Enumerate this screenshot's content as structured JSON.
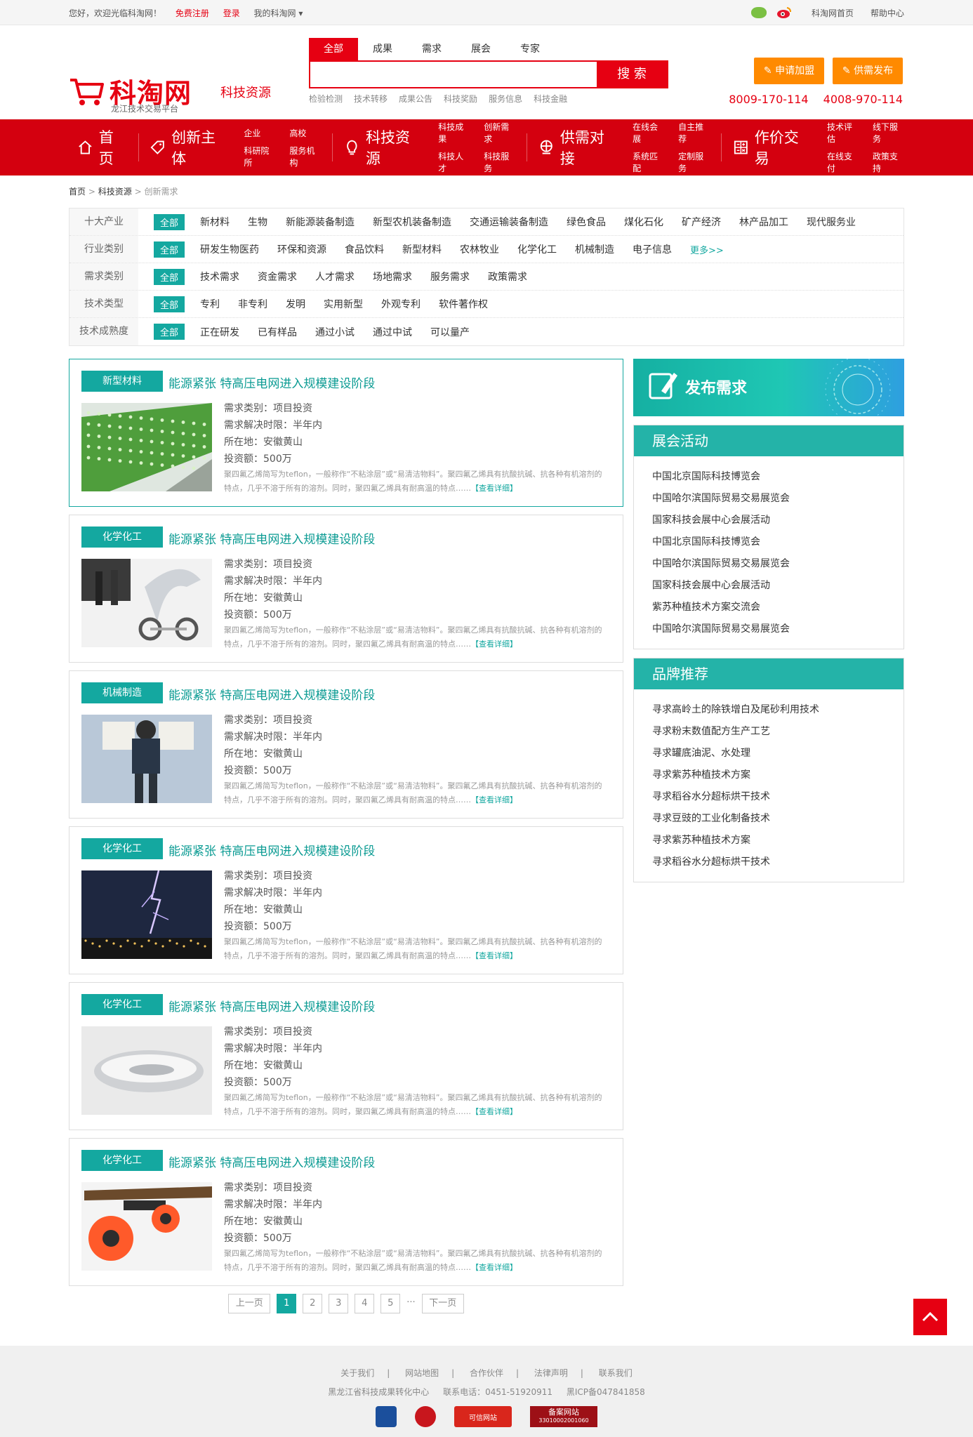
{
  "topbar": {
    "welcome": "您好，欢迎光临科淘网！",
    "register": "免费注册",
    "login": "登录",
    "my": "我的科淘网",
    "home_link": "科淘网首页",
    "help": "帮助中心"
  },
  "header": {
    "brand": "科淘网",
    "subtitle": "龙江技术交易平台",
    "section": "科技资源",
    "search_tabs": [
      "全部",
      "成果",
      "需求",
      "展会",
      "专家"
    ],
    "search_placeholder": "",
    "search_button": "搜 索",
    "hot_words": [
      "检验检测",
      "技术转移",
      "成果公告",
      "科技奖励",
      "服务信息",
      "科技金融"
    ],
    "join_button": "申请加盟",
    "publish_button": "供需发布",
    "phone1": "8009-170-114",
    "phone2": "4008-970-114"
  },
  "nav": {
    "home": "首页",
    "groups": [
      {
        "label": "创新主体",
        "subs": [
          "企业",
          "高校",
          "科研院所",
          "服务机构"
        ]
      },
      {
        "label": "科技资源",
        "subs": [
          "科技成果",
          "创新需求",
          "科技人才",
          "科技服务"
        ]
      },
      {
        "label": "供需对接",
        "subs": [
          "在线会展",
          "自主推荐",
          "系统匹配",
          "定制服务"
        ]
      },
      {
        "label": "作价交易",
        "subs": [
          "技术评估",
          "线下服务",
          "在线支付",
          "政策支持"
        ]
      }
    ]
  },
  "breadcrumb": {
    "home": "首页",
    "section": "科技资源",
    "current": "创新需求"
  },
  "filters": [
    {
      "label": "十大产业",
      "all": "全部",
      "options": [
        "新材料",
        "生物",
        "新能源装备制造",
        "新型农机装备制造",
        "交通运输装备制造",
        "绿色食品",
        "煤化石化",
        "矿产经济",
        "林产品加工",
        "现代服务业"
      ],
      "more": ""
    },
    {
      "label": "行业类别",
      "all": "全部",
      "options": [
        "研发生物医药",
        "环保和资源",
        "食品饮料",
        "新型材料",
        "农林牧业",
        "化学化工",
        "机械制造",
        "电子信息"
      ],
      "more": "更多>>"
    },
    {
      "label": "需求类别",
      "all": "全部",
      "options": [
        "技术需求",
        "资金需求",
        "人才需求",
        "场地需求",
        "服务需求",
        "政策需求"
      ],
      "more": ""
    },
    {
      "label": "技术类型",
      "all": "全部",
      "options": [
        "专利",
        "非专利",
        "发明",
        "实用新型",
        "外观专利",
        "软件著作权"
      ],
      "more": ""
    },
    {
      "label": "技术成熟度",
      "all": "全部",
      "options": [
        "正在研发",
        "已有样品",
        "通过小试",
        "通过中试",
        "可以量产"
      ],
      "more": ""
    }
  ],
  "cards": [
    {
      "tag": "新型材料",
      "title": "能源紧张 特高压电网进入规模建设阶段",
      "type": "需求类别：项目投资",
      "period": "需求解决时限：半年内",
      "location": "所在地：安徽黄山",
      "amount": "投资额：500万",
      "desc": "聚四氟乙烯简写为teflon，一般称作“不粘涂层”或“易清洁物料”。聚四氟乙烯具有抗酸抗碱、抗各种有机溶剂的特点，几乎不溶于所有的溶剂。同时，聚四氟乙烯具有耐高温的特点……",
      "more": "【查看详细】",
      "pic": "green"
    },
    {
      "tag": "化学化工",
      "title": "能源紧张 特高压电网进入规模建设阶段",
      "type": "需求类别：项目投资",
      "period": "需求解决时限：半年内",
      "location": "所在地：安徽黄山",
      "amount": "投资额：500万",
      "desc": "聚四氟乙烯简写为teflon，一般称作“不粘涂层”或“易清洁物料”。聚四氟乙烯具有抗酸抗碱、抗各种有机溶剂的特点，几乎不溶于所有的溶剂。同时，聚四氟乙烯具有耐高温的特点……",
      "more": "【查看详细】",
      "pic": "bike"
    },
    {
      "tag": "机械制造",
      "title": "能源紧张 特高压电网进入规模建设阶段",
      "type": "需求类别：项目投资",
      "period": "需求解决时限：半年内",
      "location": "所在地：安徽黄山",
      "amount": "投资额：500万",
      "desc": "聚四氟乙烯简写为teflon，一般称作“不粘涂层”或“易清洁物料”。聚四氟乙烯具有抗酸抗碱、抗各种有机溶剂的特点，几乎不溶于所有的溶剂。同时，聚四氟乙烯具有耐高温的特点……",
      "more": "【查看详细】",
      "pic": "jetpack"
    },
    {
      "tag": "化学化工",
      "title": "能源紧张 特高压电网进入规模建设阶段",
      "type": "需求类别：项目投资",
      "period": "需求解决时限：半年内",
      "location": "所在地：安徽黄山",
      "amount": "投资额：500万",
      "desc": "聚四氟乙烯简写为teflon，一般称作“不粘涂层”或“易清洁物料”。聚四氟乙烯具有抗酸抗碱、抗各种有机溶剂的特点，几乎不溶于所有的溶剂。同时，聚四氟乙烯具有耐高温的特点……",
      "more": "【查看详细】",
      "pic": "lightning"
    },
    {
      "tag": "化学化工",
      "title": "能源紧张 特高压电网进入规模建设阶段",
      "type": "需求类别：项目投资",
      "period": "需求解决时限：半年内",
      "location": "所在地：安徽黄山",
      "amount": "投资额：500万",
      "desc": "聚四氟乙烯简写为teflon，一般称作“不粘涂层”或“易清洁物料”。聚四氟乙烯具有抗酸抗碱、抗各种有机溶剂的特点，几乎不溶于所有的溶剂。同时，聚四氟乙烯具有耐高温的特点……",
      "more": "【查看详细】",
      "pic": "silver"
    },
    {
      "tag": "化学化工",
      "title": "能源紧张 特高压电网进入规模建设阶段",
      "type": "需求类别：项目投资",
      "period": "需求解决时限：半年内",
      "location": "所在地：安徽黄山",
      "amount": "投资额：500万",
      "desc": "聚四氟乙烯简写为teflon，一般称作“不粘涂层”或“易清洁物料”。聚四氟乙烯具有抗酸抗碱、抗各种有机溶剂的特点，几乎不溶于所有的溶剂。同时，聚四氟乙烯具有耐高温的特点……",
      "more": "【查看详细】",
      "pic": "skate"
    }
  ],
  "pager": {
    "prev": "上一页",
    "pages": [
      "1",
      "2",
      "3",
      "4",
      "5"
    ],
    "dots": "···",
    "next": "下一页",
    "current": "1"
  },
  "sidebar": {
    "publish": "发布需求",
    "expo_title": "展会活动",
    "expo_items": [
      "中国北京国际科技博览会",
      "中国哈尔滨国际贸易交易展览会",
      "国家科技会展中心会展活动",
      "中国北京国际科技博览会",
      "中国哈尔滨国际贸易交易展览会",
      "国家科技会展中心会展活动",
      "紫苏种植技术方案交流会",
      "中国哈尔滨国际贸易交易展览会"
    ],
    "brand_title": "品牌推荐",
    "brand_items": [
      "寻求高岭土的除铁增白及尾砂利用技术",
      "寻求粉末数值配方生产工艺",
      "寻求罐底油泥、水处理",
      "寻求紫苏种植技术方案",
      "寻求稻谷水分超标烘干技术",
      "寻求豆豉的工业化制备技术",
      "寻求紫苏种植技术方案",
      "寻求稻谷水分超标烘干技术"
    ]
  },
  "footer": {
    "links": [
      "关于我们",
      "网站地图",
      "合作伙伴",
      "法律声明",
      "联系我们"
    ],
    "org": "黑龙江省科技成果转化中心",
    "phone": "联系电话：0451-51920911",
    "icp": "黑ICP备047841858",
    "badge_credit": "可信网站",
    "badge_record": "备案网站",
    "badge_record_no": "33010002001060"
  },
  "colors": {
    "brand_red": "#e60012",
    "nav_red": "#d4000f",
    "teal": "#14a8a0",
    "orange": "#ff8a00"
  }
}
